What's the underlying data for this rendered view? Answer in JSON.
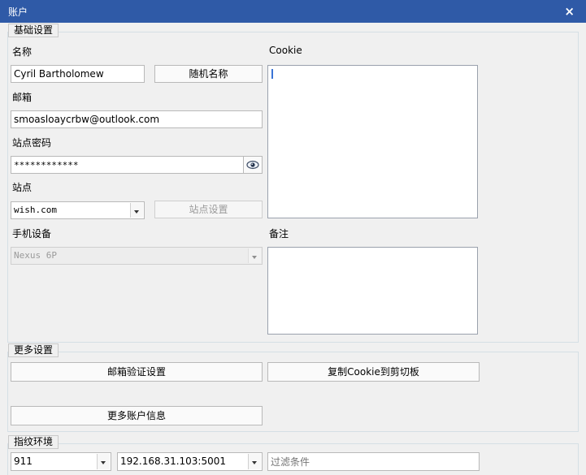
{
  "window": {
    "title": "账户",
    "close_glyph": "×"
  },
  "basic": {
    "group_label": "基础设置",
    "name_label": "名称",
    "name_value": "Cyril Bartholomew",
    "random_name_button": "随机名称",
    "email_label": "邮箱",
    "email_value": "smoasloaycrbw@outlook.com",
    "password_label": "站点密码",
    "password_value": "************",
    "site_label": "站点",
    "site_value": "wish.com",
    "site_settings_button": "站点设置",
    "device_label": "手机设备",
    "device_value": "Nexus 6P",
    "cookie_label": "Cookie",
    "note_label": "备注"
  },
  "more": {
    "group_label": "更多设置",
    "email_verify_button": "邮箱验证设置",
    "copy_cookie_button": "复制Cookie到剪切板",
    "more_info_button": "更多账户信息"
  },
  "fingerprint": {
    "group_label": "指纹环境",
    "env_value": "911",
    "proxy_value": "192.168.31.103:5001",
    "filter_placeholder": "过滤条件"
  }
}
